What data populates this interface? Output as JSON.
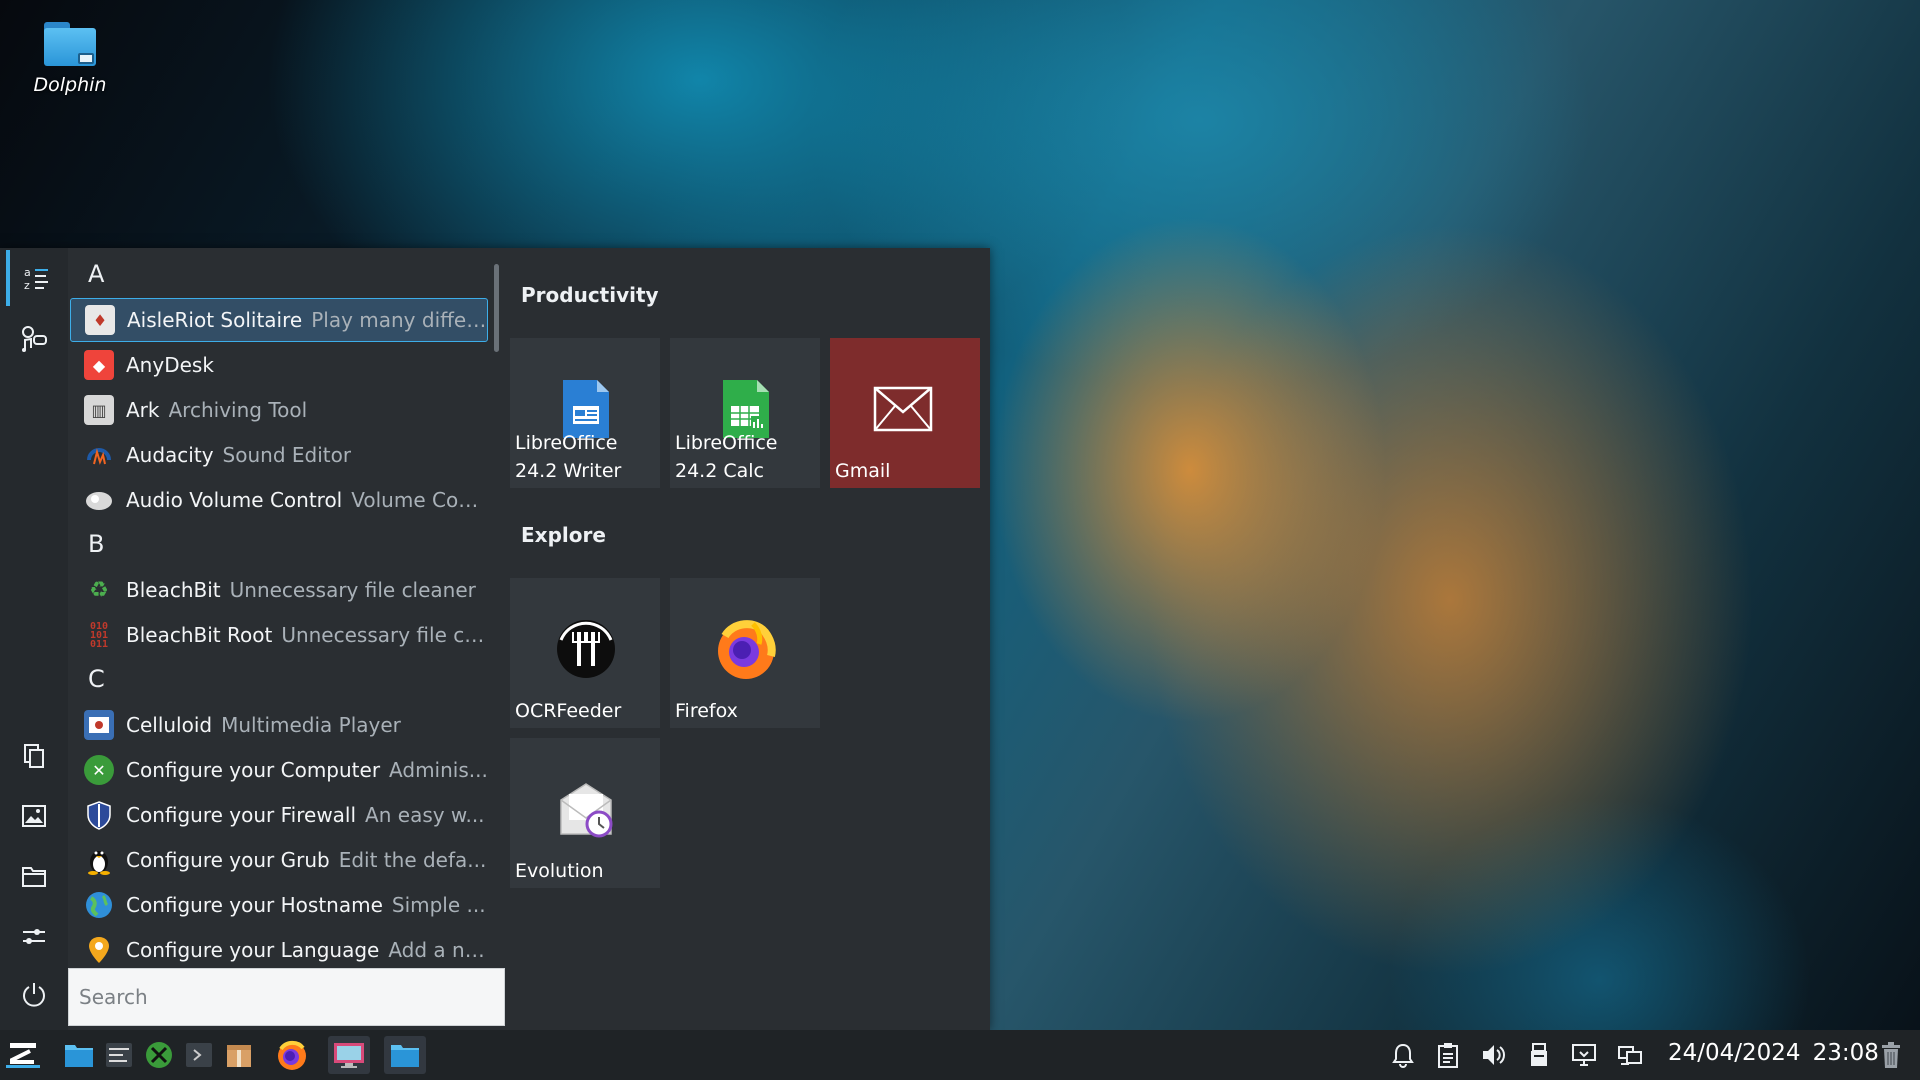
{
  "desktop": {
    "icon_label": "Dolphin"
  },
  "launcher": {
    "sections": [
      {
        "letter": "A"
      },
      {
        "letter": "B"
      },
      {
        "letter": "C"
      }
    ],
    "apps": [
      {
        "name": "AisleRiot Solitaire",
        "desc": "Play many differ...",
        "icon": "solitaire-icon",
        "selected": true
      },
      {
        "name": "AnyDesk",
        "desc": "",
        "icon": "anydesk-icon"
      },
      {
        "name": "Ark",
        "desc": "Archiving Tool",
        "icon": "ark-icon"
      },
      {
        "name": "Audacity",
        "desc": "Sound Editor",
        "icon": "audacity-icon"
      },
      {
        "name": "Audio Volume Control",
        "desc": "Volume Con...",
        "icon": "volume-control-icon"
      },
      {
        "name": "BleachBit",
        "desc": "Unnecessary file cleaner",
        "icon": "bleachbit-icon"
      },
      {
        "name": "BleachBit Root",
        "desc": "Unnecessary file cl...",
        "icon": "bleachbit-root-icon"
      },
      {
        "name": "Celluloid",
        "desc": "Multimedia Player",
        "icon": "celluloid-icon"
      },
      {
        "name": "Configure your Computer",
        "desc": "Adminis...",
        "icon": "configure-computer-icon"
      },
      {
        "name": "Configure your Firewall",
        "desc": "An easy w...",
        "icon": "firewall-icon"
      },
      {
        "name": "Configure your Grub",
        "desc": "Edit the defa...",
        "icon": "tux-icon"
      },
      {
        "name": "Configure your Hostname",
        "desc": "Simple ...",
        "icon": "globe-icon"
      },
      {
        "name": "Configure your Language",
        "desc": "Add a ne...",
        "icon": "location-pin-icon"
      }
    ],
    "search_placeholder": "Search",
    "favorites": {
      "productivity_heading": "Productivity",
      "explore_heading": "Explore",
      "tiles": [
        {
          "label": "LibreOffice 24.2 Writer",
          "icon": "libreoffice-writer-icon"
        },
        {
          "label": "LibreOffice 24.2 Calc",
          "icon": "libreoffice-calc-icon"
        },
        {
          "label": "Gmail",
          "icon": "mail-envelope-icon"
        },
        {
          "label": "OCRFeeder",
          "icon": "ocrfeeder-icon"
        },
        {
          "label": "Firefox",
          "icon": "firefox-icon"
        },
        {
          "label": "Evolution",
          "icon": "evolution-icon"
        }
      ]
    },
    "rail": [
      {
        "icon": "alphabetical-list-icon",
        "active": true
      },
      {
        "icon": "games-multimedia-icon"
      },
      {
        "icon": "documents-icon"
      },
      {
        "icon": "pictures-icon"
      },
      {
        "icon": "folder-icon"
      },
      {
        "icon": "settings-sliders-icon"
      },
      {
        "icon": "power-icon"
      }
    ]
  },
  "taskbar": {
    "date": "24/04/2024",
    "time": "23:08",
    "colors": {
      "accent": "#3daee9",
      "panel": "#1f2326",
      "gmail_tile": "#7e2c2c"
    }
  }
}
